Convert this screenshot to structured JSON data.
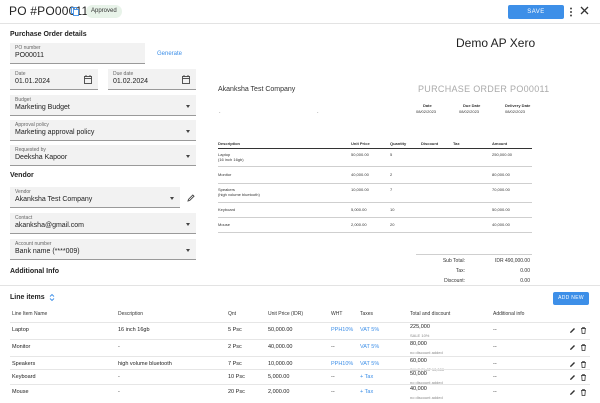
{
  "header": {
    "title": "PO #PO00011",
    "status": "Approved",
    "save_label": "SAVE"
  },
  "details": {
    "section_title": "Purchase Order details",
    "po_number": {
      "label": "PO number",
      "value": "PO00011"
    },
    "generate_label": "Generate",
    "date": {
      "label": "Date",
      "value": "01.01.2024"
    },
    "due_date": {
      "label": "Due date",
      "value": "01.02.2024"
    },
    "budget": {
      "label": "Budget",
      "value": "Marketing Budget"
    },
    "approval_policy": {
      "label": "Approval policy",
      "value": "Marketing approval policy"
    },
    "requested_by": {
      "label": "Requested by",
      "value": "Deeksha Kapoor"
    }
  },
  "vendor": {
    "section_title": "Vendor",
    "vendor": {
      "label": "Vendor",
      "value": "Akanksha Test Company"
    },
    "contact": {
      "label": "Contact",
      "value": "akanksha@gmail.com"
    },
    "account": {
      "label": "Account number",
      "value": "Bank name (****009)"
    }
  },
  "additional": {
    "section_title": "Additional Info"
  },
  "preview": {
    "company": "Demo AP Xero",
    "vendor_name": "Akanksha Test Company",
    "po_heading": "PURCHASE ORDER PO00011",
    "meta": [
      {
        "label": "Date",
        "value": "08/02/2023"
      },
      {
        "label": "Due Date",
        "value": "08/02/2023"
      },
      {
        "label": "Delivery Date",
        "value": "08/02/2023"
      }
    ],
    "dash1": "-",
    "dash2": "-",
    "columns": [
      "Description",
      "Unit Price",
      "Quantity",
      "Discount",
      "Tax",
      "Amount"
    ],
    "rows": [
      {
        "desc": "Laptop",
        "desc2": "(16 inch 16gb)",
        "price": "50,000.00",
        "qty": "5",
        "amount": "250,000.00"
      },
      {
        "desc": "Monitor",
        "desc2": "",
        "price": "40,000.00",
        "qty": "2",
        "amount": "80,000.00"
      },
      {
        "desc": "Speakers",
        "desc2": "(high volume bluetooth)",
        "price": "10,000.00",
        "qty": "7",
        "amount": "70,000.00"
      },
      {
        "desc": "Keyboard",
        "desc2": "",
        "price": "5,000.00",
        "qty": "10",
        "amount": "50,000.00"
      },
      {
        "desc": "Mouse",
        "desc2": "",
        "price": "2,000.00",
        "qty": "20",
        "amount": "40,000.00"
      }
    ],
    "subtotal_label": "Sub Total:",
    "subtotal_value": "IDR 490,000.00",
    "tax_label": "Tax:",
    "tax_value": "0.00",
    "discount_label": "Discount:",
    "discount_value": "0.00"
  },
  "line_items": {
    "title": "Line items",
    "new_label": "ADD NEW",
    "columns": [
      "Line Item Name",
      "Description",
      "Qnt",
      "Unit Price (IDR)",
      "WHT",
      "Taxes",
      "Total and discount",
      "Additional info"
    ],
    "rows": [
      {
        "name": "Laptop",
        "desc": "16 inch 16gb",
        "qnt": "5 Psc",
        "price": "50,000.00",
        "wht": "PPH10%",
        "taxes": "VAT 5%",
        "total": "225,000",
        "discount": "SALE 10%",
        "info": "--"
      },
      {
        "name": "Monitor",
        "desc": "-",
        "qnt": "2 Psc",
        "price": "40,000.00",
        "wht": "--",
        "taxes": "VAT 5%",
        "total": "80,000",
        "discount": "no discount added",
        "info": "--"
      },
      {
        "name": "Speakers",
        "desc": "high volume bluetooth",
        "qnt": "7 Psc",
        "price": "10,000.00",
        "wht": "PPH10%",
        "taxes": "VAT 5%",
        "total": "60,000",
        "discount": "SALE FLAT 10,000",
        "info": "--"
      },
      {
        "name": "Keyboard",
        "desc": "-",
        "qnt": "10 Psc",
        "price": "5,000.00",
        "wht": "--",
        "taxes": "+ Tax",
        "total": "50,000",
        "discount": "no discount added",
        "info": "--"
      },
      {
        "name": "Mouse",
        "desc": "-",
        "qnt": "20 Psc",
        "price": "2,000.00",
        "wht": "--",
        "taxes": "+ Tax",
        "total": "40,000",
        "discount": "no discount added",
        "info": "--"
      }
    ]
  },
  "colors": {
    "accent": "#3d8fe8",
    "badge_bg": "#e8f3e9",
    "field_bg": "#f2f2f2"
  },
  "icons": [
    "copy-icon",
    "kebab-menu-icon",
    "close-icon",
    "calendar-icon",
    "chevron-down-icon",
    "pencil-icon",
    "sort-icon",
    "edit-icon",
    "trash-icon"
  ]
}
